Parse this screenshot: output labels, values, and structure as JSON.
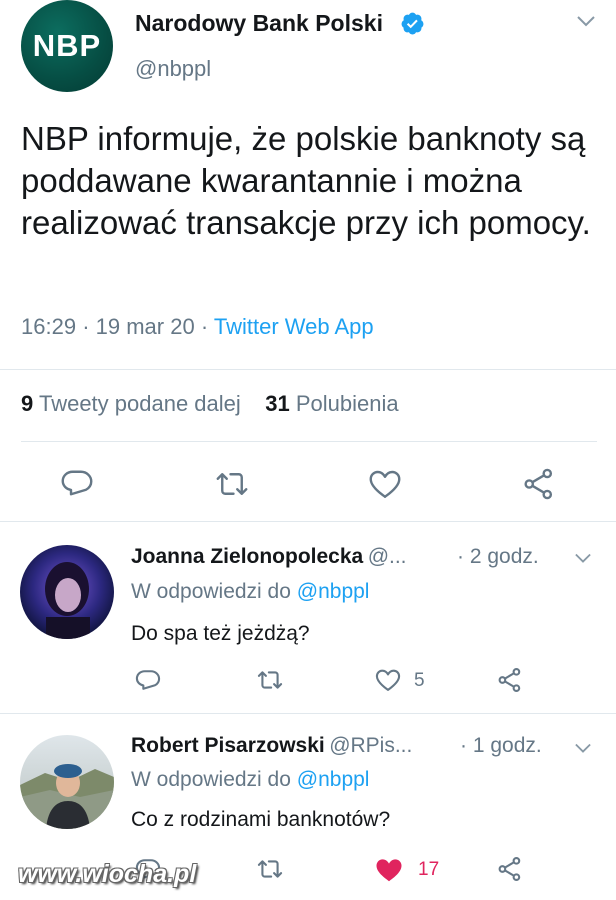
{
  "colors": {
    "accent": "#1da1f2",
    "text": "#14171a",
    "secondary": "#657786",
    "like_red": "#e0245e",
    "divider": "#e1e8ed",
    "nbp_green": "#064d43"
  },
  "tweet": {
    "avatar_text": "NBP",
    "author_name": "Narodowy Bank Polski",
    "handle": "@nbppl",
    "verified": true,
    "text": "NBP informuje, że polskie banknoty są poddawane kwarantannie i można realizować transakcje przy ich pomocy.",
    "time": "16:29",
    "date": "19 mar 20",
    "separator": "·",
    "source": "Twitter Web App",
    "retweets_count": "9",
    "retweets_label": "Tweety podane dalej",
    "likes_count": "31",
    "likes_label": "Polubienia",
    "icons": [
      "reply-icon",
      "retweet-icon",
      "like-icon",
      "share-icon",
      "chevron-down-icon",
      "verified-icon"
    ]
  },
  "replies": [
    {
      "author_name": "Joanna Zielonopolecka",
      "handle": "@...",
      "age": "· 2 godz.",
      "reply_to_prefix": "W odpowiedzi do",
      "reply_to": "@nbppl",
      "text": "Do spa też jeżdżą?",
      "likes": "5",
      "liked": false
    },
    {
      "author_name": "Robert Pisarzowski",
      "handle": "@RPis...",
      "age": "· 1 godz.",
      "reply_to_prefix": "W odpowiedzi do",
      "reply_to": "@nbppl",
      "text": "Co z rodzinami banknotów?",
      "likes": "17",
      "liked": true
    }
  ],
  "watermark": "www.wiocha.pl"
}
